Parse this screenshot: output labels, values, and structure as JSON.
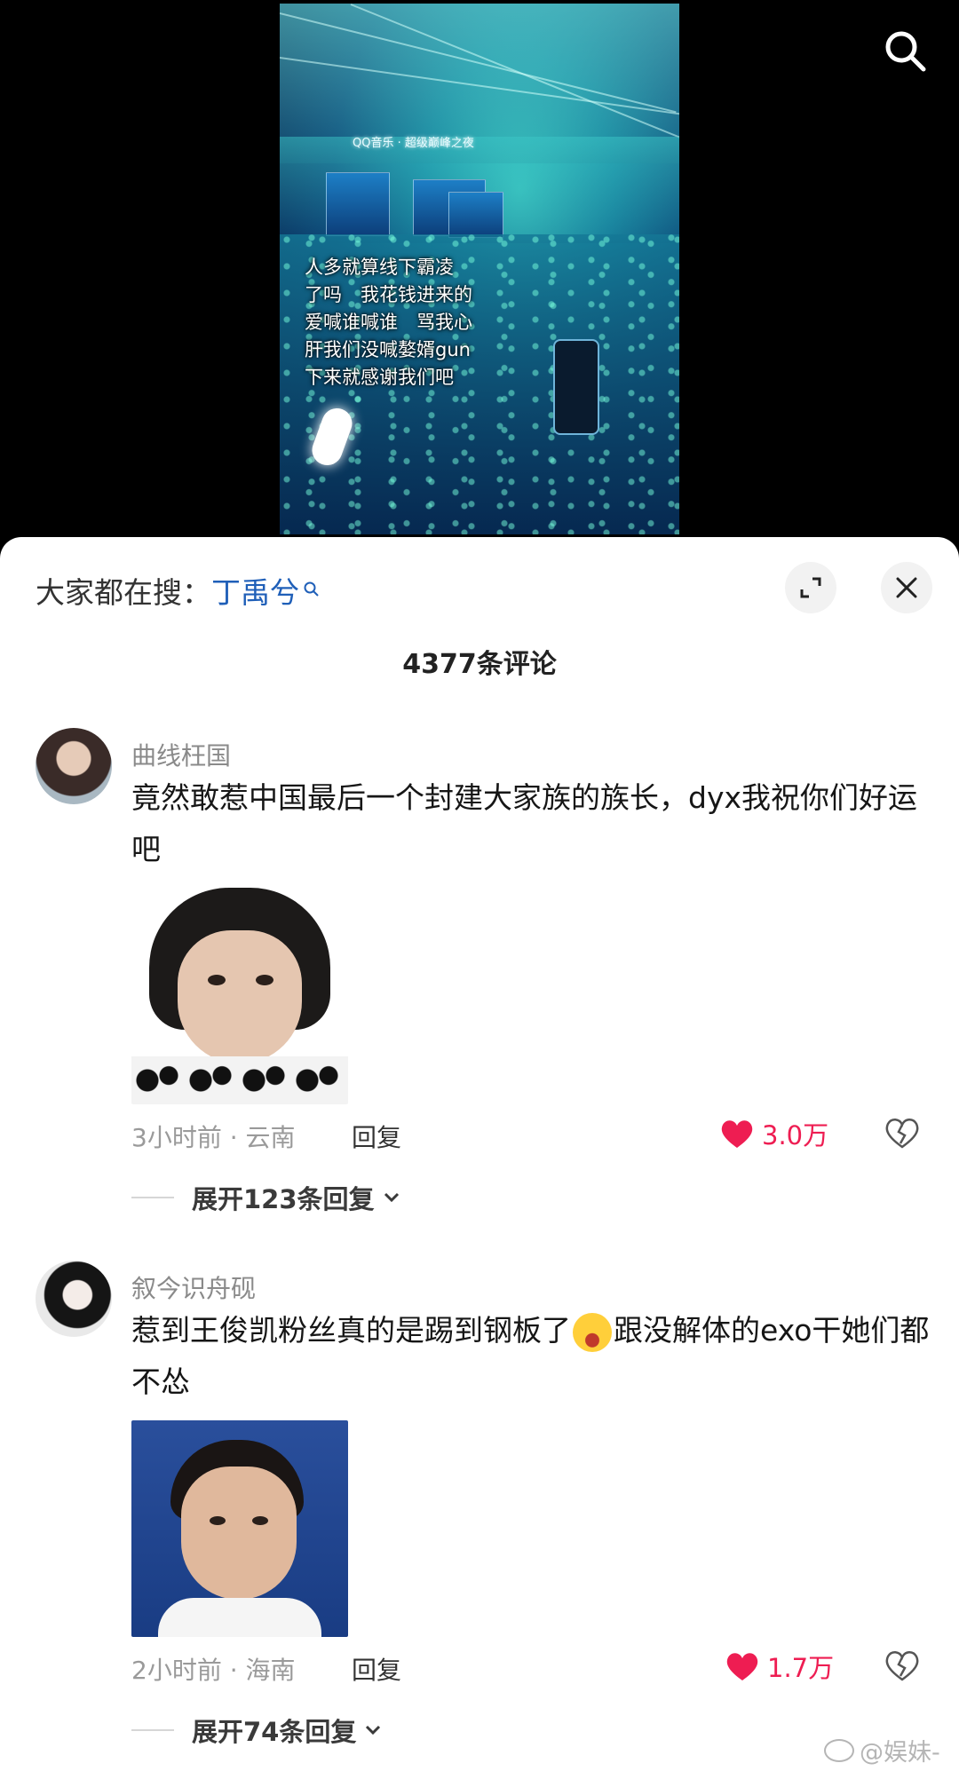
{
  "video": {
    "venue_caption": "QQ音乐 · 超级巅峰之夜",
    "overlay_lines": [
      "人多就算线下霸凌",
      "了吗　我花钱进来的",
      "爱喊谁喊谁　骂我心",
      "肝我们没喊嫯婿gun",
      "下来就感谢我们吧"
    ]
  },
  "header": {
    "search_prefix": "大家都在搜：",
    "search_term": "丁禹兮",
    "comment_count": "4377条评论"
  },
  "comments": [
    {
      "username": "曲线枉国",
      "text": "竟然敢惹中国最后一个封建大家族的族长，dyx我祝你们好运吧",
      "meta": "3小时前 · 云南",
      "reply_label": "回复",
      "likes": "3.0万",
      "expand_label": "展开123条回复"
    },
    {
      "username": "叙今识舟砚",
      "text_before_emoji": "惹到王俊凯粉丝真的是踢到钢板了",
      "text_after_emoji": "跟没解体的exo干她们都不怂",
      "meta": "2小时前 · 海南",
      "reply_label": "回复",
      "likes": "1.7万",
      "expand_label": "展开74条回复"
    }
  ],
  "watermark": "@娱妹-",
  "colors": {
    "like_red": "#ee1d52",
    "search_term_blue": "#1f5fb8"
  }
}
